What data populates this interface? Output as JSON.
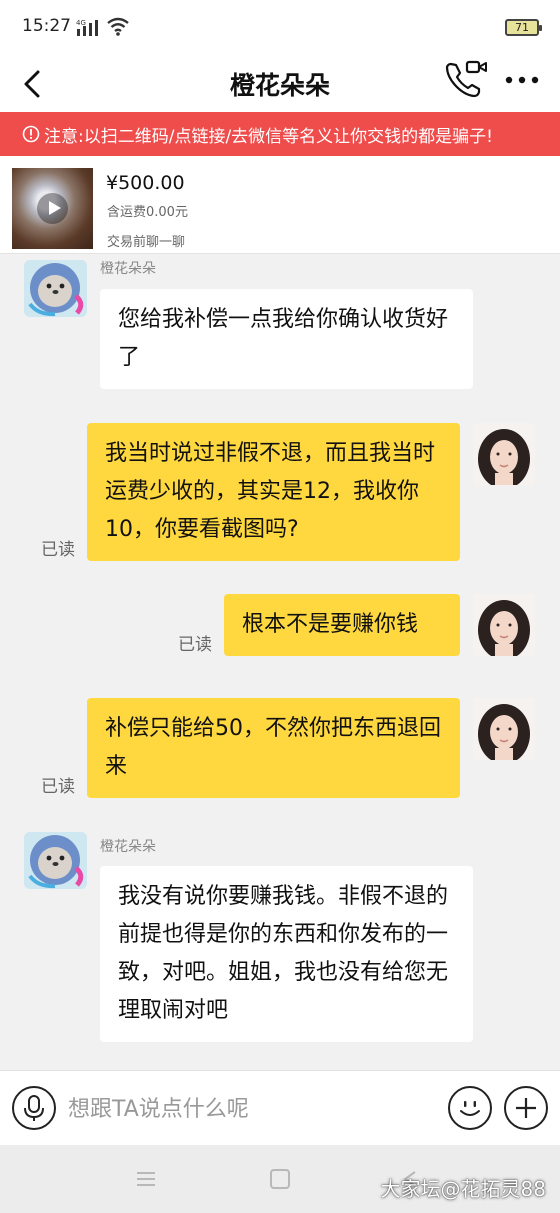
{
  "status_bar": {
    "time": "15:27",
    "network": "4G",
    "battery": "71"
  },
  "header": {
    "title": "橙花朵朵"
  },
  "warning": {
    "text": "注意:以扫二维码/点链接/去微信等名义让你交钱的都是骗子!"
  },
  "product": {
    "price": "¥500.00",
    "shipping": "含运费0.00元",
    "chat_prompt": "交易前聊一聊"
  },
  "messages": [
    {
      "side": "in",
      "sender": "橙花朵朵",
      "text": "您给我补偿一点我给你确认收货好了"
    },
    {
      "side": "out",
      "status": "已读",
      "text": "我当时说过非假不退，而且我当时运费少收的，其实是12，我收你10，你要看截图吗?"
    },
    {
      "side": "out",
      "status": "已读",
      "text": "根本不是要赚你钱"
    },
    {
      "side": "out",
      "status": "已读",
      "text": "补偿只能给50，不然你把东西退回来"
    },
    {
      "side": "in",
      "sender": "橙花朵朵",
      "text": "我没有说你要赚我钱。非假不退的前提也得是你的东西和你发布的一致，对吧。姐姐，我也没有给您无理取闹对吧"
    }
  ],
  "input": {
    "placeholder": "想跟TA说点什么呢"
  },
  "watermark": "大家坛@花拓灵88",
  "colors": {
    "warning_bg": "#ef4c4c",
    "outgoing_bubble": "#ffd73f",
    "incoming_bubble": "#ffffff",
    "chat_bg": "#f1f1f1"
  }
}
